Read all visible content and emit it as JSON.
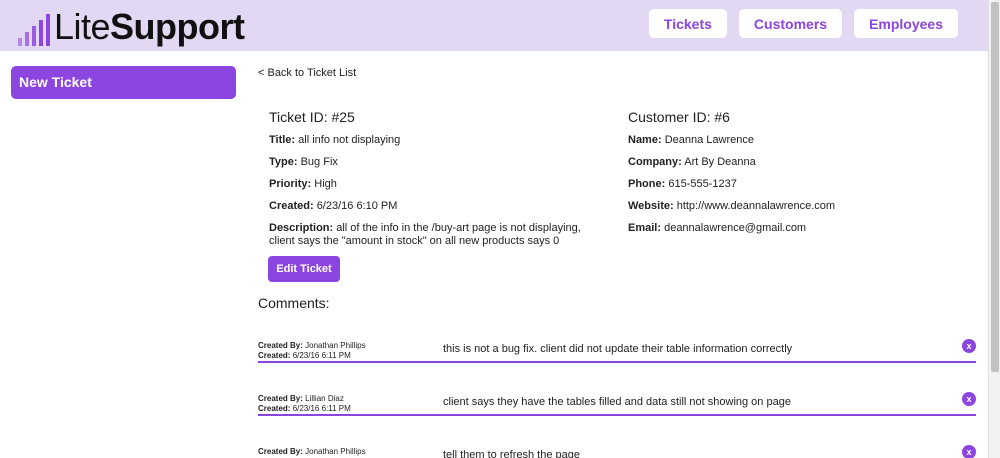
{
  "app": {
    "logo_lite": "Lite",
    "logo_support": "Support"
  },
  "nav": {
    "tickets": "Tickets",
    "customers": "Customers",
    "employees": "Employees"
  },
  "sidebar": {
    "new_ticket": "New Ticket"
  },
  "back_link": "< Back to Ticket List",
  "ticket": {
    "heading": "Ticket ID: #25",
    "title_label": "Title:",
    "title_value": "all info not displaying",
    "type_label": "Type:",
    "type_value": "Bug Fix",
    "priority_label": "Priority:",
    "priority_value": "High",
    "created_label": "Created:",
    "created_value": "6/23/16 6:10 PM",
    "description_label": "Description:",
    "description_value": "all of the info in the /buy-art page is not displaying, client says the \"amount in stock\" on all new products says 0",
    "edit_button": "Edit Ticket"
  },
  "customer": {
    "heading": "Customer ID: #6",
    "name_label": "Name:",
    "name_value": "Deanna Lawrence",
    "company_label": "Company:",
    "company_value": "Art By Deanna",
    "phone_label": "Phone:",
    "phone_value": "615-555-1237",
    "website_label": "Website:",
    "website_value": "http://www.deannalawrence.com",
    "email_label": "Email:",
    "email_value": "deannalawrence@gmail.com"
  },
  "comments": {
    "heading": "Comments:",
    "created_by_label": "Created By:",
    "created_label": "Created:",
    "delete_label": "x",
    "items": [
      {
        "author": "Jonathan Phillips",
        "created": "6/23/16 6:11 PM",
        "text": "this is not a bug fix. client did not update their table information correctly"
      },
      {
        "author": "Lillian Diaz",
        "created": "6/23/16 6:11 PM",
        "text": "client says they have the tables filled and data still not showing on page"
      },
      {
        "author": "Jonathan Phillips",
        "created": "",
        "text": "tell them to refresh the page"
      }
    ]
  },
  "colors": {
    "accent": "#8c45e0",
    "header_bg": "#e3d8f4"
  }
}
